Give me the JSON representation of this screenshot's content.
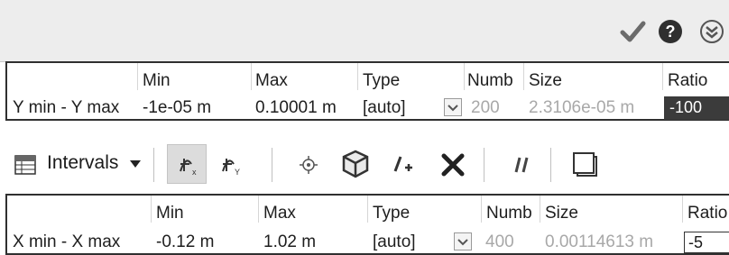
{
  "title_bar": {
    "icons": [
      "checkmark-icon",
      "help-icon",
      "collapse-icon"
    ]
  },
  "y_table": {
    "headers": {
      "min": "Min",
      "max": "Max",
      "type": "Type",
      "number": "Numb",
      "size": "Size",
      "ratio": "Ratio"
    },
    "row": {
      "label": "Y min - Y max",
      "min": "-1e-05 m",
      "max": "0.10001 m",
      "type": "[auto]",
      "number": "200",
      "size": "2.3106e-05 m",
      "ratio": "-100"
    }
  },
  "toolbar": {
    "intervals_label": "Intervals",
    "icons": [
      "table-icon",
      "dropdown-arrow-icon",
      "x-axis-icon",
      "y-axis-icon",
      "target-icon",
      "cube-icon",
      "add-point-icon",
      "delete-icon",
      "pair-icon",
      "box-icon"
    ]
  },
  "x_table": {
    "headers": {
      "min": "Min",
      "max": "Max",
      "type": "Type",
      "number": "Numb",
      "size": "Size",
      "ratio": "Ratio"
    },
    "row": {
      "label": "X min - X max",
      "min": "-0.12 m",
      "max": "1.02 m",
      "type": "[auto]",
      "number": "400",
      "size": "0.00114613 m",
      "ratio": "-5"
    }
  },
  "colors": {
    "ratio_highlight": "#3b3b3b",
    "header_bar": "#ededed",
    "active_button": "#dcdcdc"
  }
}
